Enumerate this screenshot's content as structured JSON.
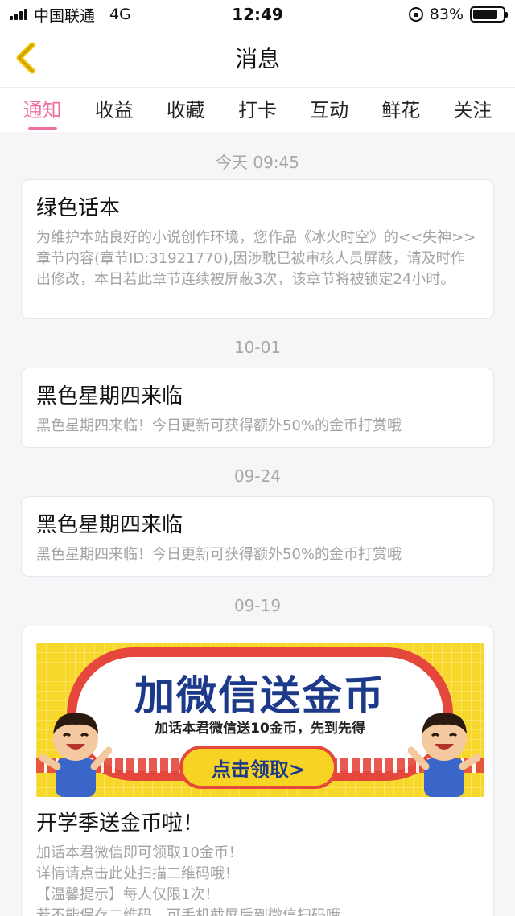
{
  "status_bar": {
    "carrier": "中国联通",
    "network": "4G",
    "time": "12:49",
    "battery": "83%",
    "battery_level": 0.83
  },
  "nav": {
    "title": "消息"
  },
  "tabs": [
    {
      "label": "通知",
      "active": true
    },
    {
      "label": "收益",
      "active": false
    },
    {
      "label": "收藏",
      "active": false
    },
    {
      "label": "打卡",
      "active": false
    },
    {
      "label": "互动",
      "active": false
    },
    {
      "label": "鲜花",
      "active": false
    },
    {
      "label": "关注",
      "active": false
    }
  ],
  "colors": {
    "accent": "#f06fa0",
    "banner_yellow": "#f8d72b",
    "banner_red": "#e5473c",
    "banner_blue": "#1d3a8a"
  },
  "messages": [
    {
      "date": "今天 09:45",
      "title": "绿色话本",
      "body": "为维护本站良好的小说创作环境，您作品《冰火时空》的<<失神>>章节内容(章节ID:31921770),因涉耽已被审核人员屏蔽，请及时作出修改，本日若此章节连续被屏蔽3次，该章节将被锁定24小时。"
    },
    {
      "date": "10-01",
      "title": "黑色星期四来临",
      "body": "黑色星期四来临！今日更新可获得额外50%的金币打赏哦"
    },
    {
      "date": "09-24",
      "title": "黑色星期四来临",
      "body": "黑色星期四来临！今日更新可获得额外50%的金币打赏哦"
    },
    {
      "date": "09-19",
      "banner": {
        "title": "加微信送金币",
        "subtitle": "加话本君微信送10金币，先到先得",
        "button": "点击领取>"
      },
      "title": "开学季送金币啦！",
      "lines": [
        "加话本君微信即可领取10金币！",
        "详情请点击此处扫描二维码哦！",
        "【温馨提示】每人仅限1次！",
        "若不能保存二维码，可手机截屏后到微信扫码哦"
      ]
    }
  ]
}
